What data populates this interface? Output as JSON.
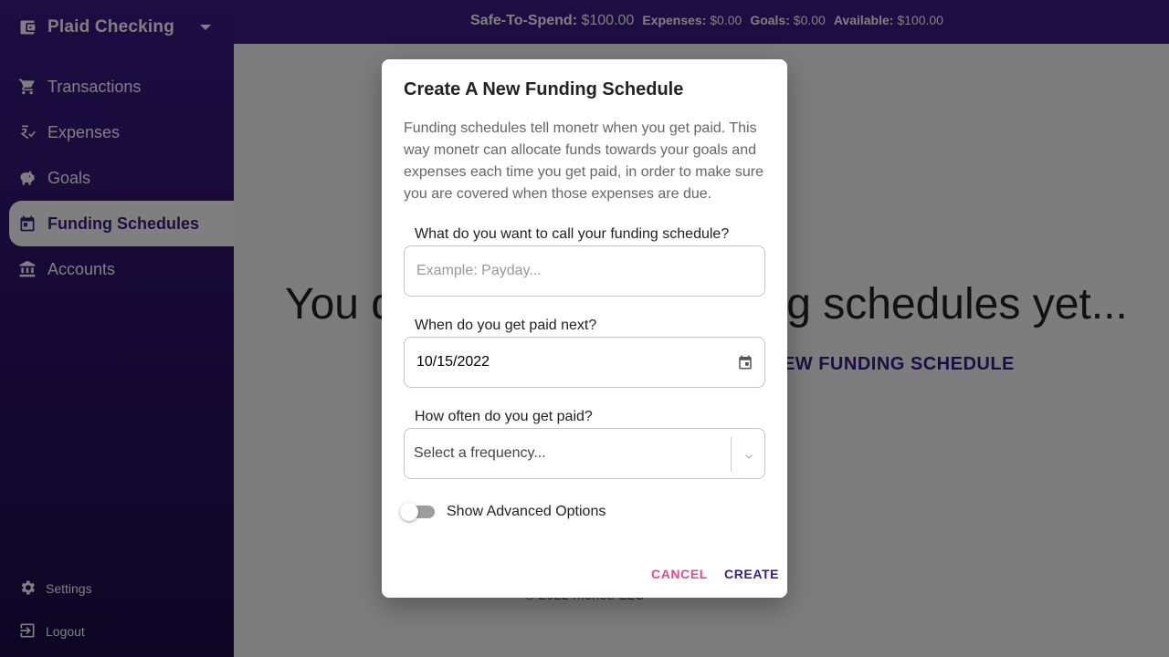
{
  "topbar": {
    "safe_label": "Safe-To-Spend:",
    "safe_value": "$100.00",
    "expenses_label": "Expenses:",
    "expenses_value": "$0.00",
    "goals_label": "Goals:",
    "goals_value": "$0.00",
    "available_label": "Available:",
    "available_value": "$100.00"
  },
  "sidebar": {
    "account_name": "Plaid Checking",
    "items": [
      {
        "label": "Transactions",
        "icon": "cart-icon"
      },
      {
        "label": "Expenses",
        "icon": "expenses-icon"
      },
      {
        "label": "Goals",
        "icon": "piggy-bank-icon"
      },
      {
        "label": "Funding Schedules",
        "icon": "calendar-icon",
        "active": true
      },
      {
        "label": "Accounts",
        "icon": "bank-icon"
      }
    ],
    "settings_label": "Settings",
    "logout_label": "Logout"
  },
  "main": {
    "empty_title": "You don't have any funding schedules yet...",
    "empty_button": "NEW FUNDING SCHEDULE",
    "footer": "© 2022 monetr LLC"
  },
  "dialog": {
    "title": "Create A New Funding Schedule",
    "description": "Funding schedules tell monetr when you get paid. This way monetr can allocate funds towards your goals and expenses each time you get paid, in order to make sure you are covered when those expenses are due.",
    "name_label": "What do you want to call your funding schedule?",
    "name_placeholder": "Example: Payday...",
    "date_label": "When do you get paid next?",
    "date_value": "10/15/2022",
    "frequency_label": "How often do you get paid?",
    "frequency_placeholder": "Select a frequency...",
    "advanced_label": "Show Advanced Options",
    "advanced_enabled": false,
    "cancel_label": "CANCEL",
    "create_label": "CREATE"
  },
  "colors": {
    "brand": "#3b1a86",
    "cancel": "#e8478f"
  }
}
